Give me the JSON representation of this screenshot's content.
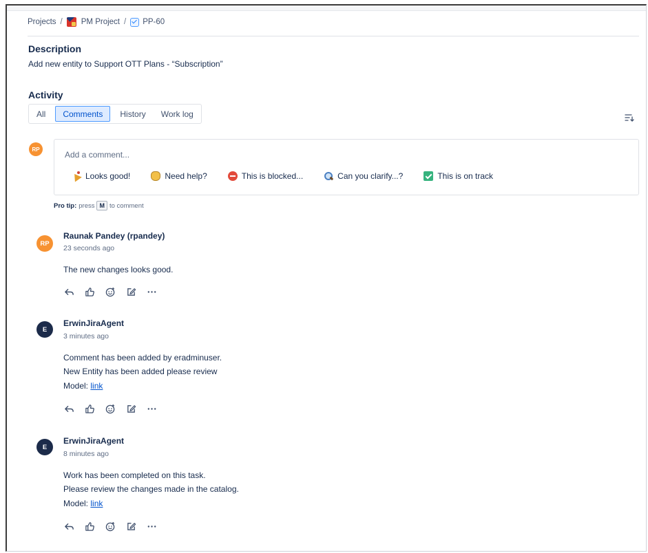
{
  "breadcrumb": {
    "projects": "Projects",
    "separator": "/",
    "project_name": "PM Project",
    "issue_key": "PP-60"
  },
  "description": {
    "title": "Description",
    "text": "Add new entity to Support OTT Plans - “Subscription”"
  },
  "activity": {
    "title": "Activity",
    "tabs": [
      {
        "label": "All",
        "active": false
      },
      {
        "label": "Comments",
        "active": true
      },
      {
        "label": "History",
        "active": false
      },
      {
        "label": "Work log",
        "active": false
      }
    ]
  },
  "comment_editor": {
    "avatar_initials": "RP",
    "placeholder": "Add a comment...",
    "quick_replies": [
      {
        "icon": "party-popper-icon",
        "label": "Looks good!"
      },
      {
        "icon": "waving-hand-icon",
        "label": "Need help?"
      },
      {
        "icon": "no-entry-icon",
        "label": "This is blocked..."
      },
      {
        "icon": "magnifying-glass-icon",
        "label": "Can you clarify...?"
      },
      {
        "icon": "check-mark-icon",
        "label": "This is on track"
      }
    ],
    "protip_label": "Pro tip:",
    "protip_press": "press",
    "protip_key": "M",
    "protip_suffix": "to comment"
  },
  "comments": [
    {
      "author": "Raunak Pandey (rpandey)",
      "initials": "RP",
      "avatar_color": "#f79232",
      "time": "23 seconds ago",
      "lines": [
        "The new changes looks good."
      ]
    },
    {
      "author": "ErwinJiraAgent",
      "initials": "E",
      "avatar_color": "#1c2b4a",
      "time": "3 minutes ago",
      "lines": [
        "Comment has been added by eradminuser.",
        "New Entity has been added please review"
      ],
      "model_label": "Model:",
      "link_text": "link"
    },
    {
      "author": "ErwinJiraAgent",
      "initials": "E",
      "avatar_color": "#1c2b4a",
      "time": "8 minutes ago",
      "lines": [
        "Work has been completed on this task.",
        "Please review the changes made in the catalog."
      ],
      "model_label": "Model:",
      "link_text": "link"
    }
  ],
  "colors": {
    "accent": "#0052cc",
    "active_tab_bg": "#deebff",
    "text": "#172b4d",
    "muted": "#5e6c84"
  }
}
